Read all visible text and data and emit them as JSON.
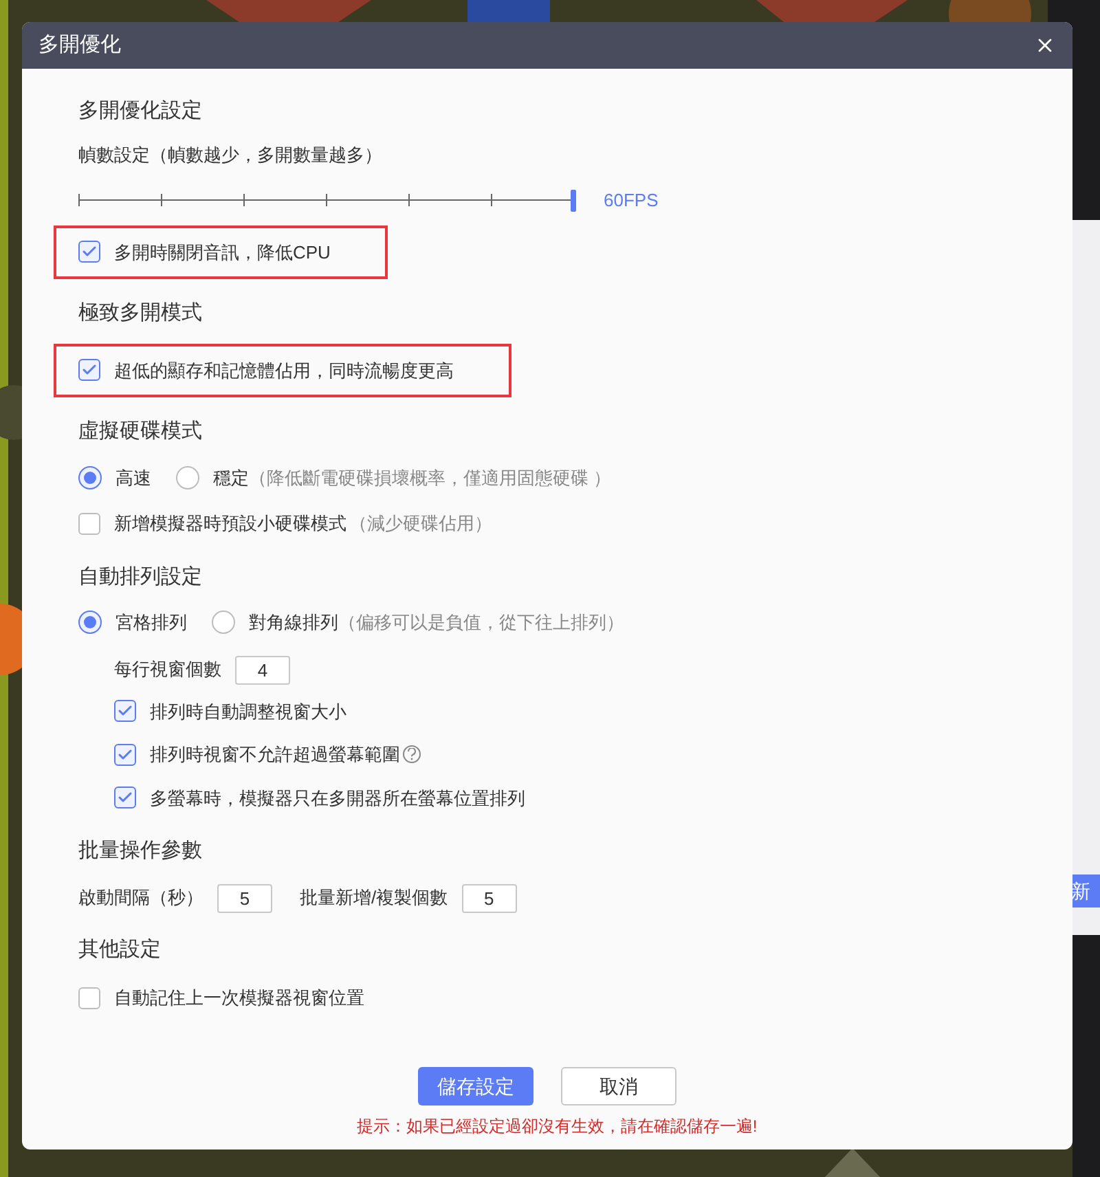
{
  "background_app": {
    "button_label": "新"
  },
  "dialog": {
    "title": "多開優化",
    "sections": [
      {
        "heading": "多開優化設定",
        "items": [
          {
            "kind": "slider",
            "label": "幀數設定（幀數越少，多開數量越多）",
            "level": 1,
            "reading": "60FPS"
          },
          {
            "kind": "checkbox",
            "label": "多開時關閉音訊，降低CPU",
            "checked": true,
            "highlighted": true
          }
        ]
      },
      {
        "heading": "極致多開模式",
        "items": [
          {
            "kind": "checkbox",
            "label": "超低的顯存和記憶體佔用，同時流暢度更高",
            "checked": true,
            "highlighted": true
          }
        ]
      },
      {
        "heading": "虛擬硬碟模式",
        "items": [
          {
            "kind": "radios",
            "options": [
              {
                "label": "高速",
                "selected": true
              },
              {
                "label": "穩定",
                "note": "（降低斷電硬碟損壞概率，僅適用固態硬碟 ）",
                "selected": false
              }
            ]
          },
          {
            "kind": "checkbox",
            "label": "新增模擬器時預設小硬碟模式",
            "note": "（減少硬碟佔用）",
            "checked": false,
            "highlighted": false
          }
        ]
      },
      {
        "heading": "自動排列設定",
        "items": [
          {
            "kind": "radios",
            "options": [
              {
                "label": "宮格排列",
                "selected": true
              },
              {
                "label": "對角線排列",
                "note": "（偏移可以是負值，從下往上排列）",
                "selected": false
              }
            ],
            "children": [
              {
                "kind": "fields",
                "fields": [
                  {
                    "label": "每行視窗個數",
                    "value": "4"
                  }
                ]
              },
              {
                "kind": "checkbox",
                "label": "排列時自動調整視窗大小",
                "checked": true,
                "highlighted": false
              },
              {
                "kind": "checkbox",
                "label": "排列時視窗不允許超過螢幕範圍",
                "checked": true,
                "highlighted": false,
                "help": true
              },
              {
                "kind": "checkbox",
                "label": "多螢幕時，模擬器只在多開器所在螢幕位置排列",
                "checked": true,
                "highlighted": false
              }
            ]
          }
        ]
      },
      {
        "heading": "批量操作參數",
        "items": [
          {
            "kind": "fields",
            "fields": [
              {
                "label": "啟動間隔（秒）",
                "value": "5"
              },
              {
                "label": "批量新增/複製個數",
                "value": "5"
              }
            ]
          }
        ]
      },
      {
        "heading": "其他設定",
        "items": [
          {
            "kind": "checkbox",
            "label": "自動記住上一次模擬器視窗位置",
            "checked": false,
            "highlighted": false
          }
        ]
      }
    ],
    "buttons": [
      {
        "label": "儲存設定",
        "kind": "primary"
      },
      {
        "label": "取消",
        "kind": "secondary"
      }
    ],
    "hint": "提示：如果已經設定過卻沒有生效，請在確認儲存一遍!"
  }
}
